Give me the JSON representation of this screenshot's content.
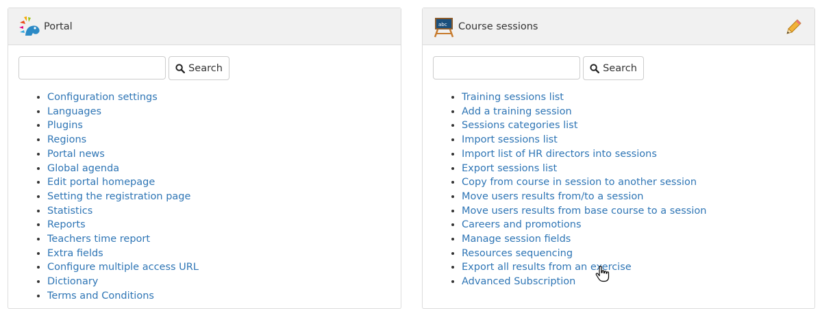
{
  "portal": {
    "title": "Portal",
    "search_button": "Search",
    "search_value": "",
    "links": [
      "Configuration settings",
      "Languages",
      "Plugins",
      "Regions",
      "Portal news",
      "Global agenda",
      "Edit portal homepage",
      "Setting the registration page",
      "Statistics",
      "Reports",
      "Teachers time report",
      "Extra fields",
      "Configure multiple access URL",
      "Dictionary",
      "Terms and Conditions"
    ]
  },
  "sessions": {
    "title": "Course sessions",
    "search_button": "Search",
    "search_value": "",
    "links": [
      "Training sessions list",
      "Add a training session",
      "Sessions categories list",
      "Import sessions list",
      "Import list of HR directors into sessions",
      "Export sessions list",
      "Copy from course in session to another session",
      "Move users results from/to a session",
      "Move users results from base course to a session",
      "Careers and promotions",
      "Manage session fields",
      "Resources sequencing",
      "Export all results from an exercise",
      "Advanced Subscription"
    ]
  },
  "colors": {
    "link": "#2e75b5",
    "header_bg": "#f1f1f1",
    "border": "#dcdcdc"
  },
  "icons": {
    "portal": "chamilo-logo-icon",
    "sessions": "blackboard-icon",
    "edit": "pencil-icon",
    "search": "magnifier-icon",
    "cursor": "hand-pointer-icon"
  }
}
